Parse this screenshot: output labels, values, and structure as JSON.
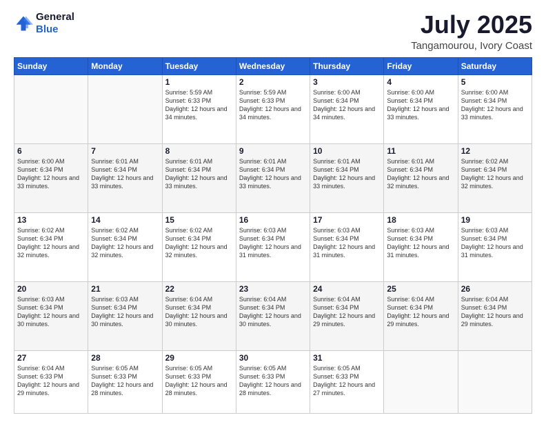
{
  "logo": {
    "line1": "General",
    "line2": "Blue"
  },
  "title": "July 2025",
  "subtitle": "Tangamourou, Ivory Coast",
  "days_header": [
    "Sunday",
    "Monday",
    "Tuesday",
    "Wednesday",
    "Thursday",
    "Friday",
    "Saturday"
  ],
  "weeks": [
    [
      {
        "day": "",
        "info": ""
      },
      {
        "day": "",
        "info": ""
      },
      {
        "day": "1",
        "info": "Sunrise: 5:59 AM\nSunset: 6:33 PM\nDaylight: 12 hours and 34 minutes."
      },
      {
        "day": "2",
        "info": "Sunrise: 5:59 AM\nSunset: 6:33 PM\nDaylight: 12 hours and 34 minutes."
      },
      {
        "day": "3",
        "info": "Sunrise: 6:00 AM\nSunset: 6:34 PM\nDaylight: 12 hours and 34 minutes."
      },
      {
        "day": "4",
        "info": "Sunrise: 6:00 AM\nSunset: 6:34 PM\nDaylight: 12 hours and 33 minutes."
      },
      {
        "day": "5",
        "info": "Sunrise: 6:00 AM\nSunset: 6:34 PM\nDaylight: 12 hours and 33 minutes."
      }
    ],
    [
      {
        "day": "6",
        "info": "Sunrise: 6:00 AM\nSunset: 6:34 PM\nDaylight: 12 hours and 33 minutes."
      },
      {
        "day": "7",
        "info": "Sunrise: 6:01 AM\nSunset: 6:34 PM\nDaylight: 12 hours and 33 minutes."
      },
      {
        "day": "8",
        "info": "Sunrise: 6:01 AM\nSunset: 6:34 PM\nDaylight: 12 hours and 33 minutes."
      },
      {
        "day": "9",
        "info": "Sunrise: 6:01 AM\nSunset: 6:34 PM\nDaylight: 12 hours and 33 minutes."
      },
      {
        "day": "10",
        "info": "Sunrise: 6:01 AM\nSunset: 6:34 PM\nDaylight: 12 hours and 33 minutes."
      },
      {
        "day": "11",
        "info": "Sunrise: 6:01 AM\nSunset: 6:34 PM\nDaylight: 12 hours and 32 minutes."
      },
      {
        "day": "12",
        "info": "Sunrise: 6:02 AM\nSunset: 6:34 PM\nDaylight: 12 hours and 32 minutes."
      }
    ],
    [
      {
        "day": "13",
        "info": "Sunrise: 6:02 AM\nSunset: 6:34 PM\nDaylight: 12 hours and 32 minutes."
      },
      {
        "day": "14",
        "info": "Sunrise: 6:02 AM\nSunset: 6:34 PM\nDaylight: 12 hours and 32 minutes."
      },
      {
        "day": "15",
        "info": "Sunrise: 6:02 AM\nSunset: 6:34 PM\nDaylight: 12 hours and 32 minutes."
      },
      {
        "day": "16",
        "info": "Sunrise: 6:03 AM\nSunset: 6:34 PM\nDaylight: 12 hours and 31 minutes."
      },
      {
        "day": "17",
        "info": "Sunrise: 6:03 AM\nSunset: 6:34 PM\nDaylight: 12 hours and 31 minutes."
      },
      {
        "day": "18",
        "info": "Sunrise: 6:03 AM\nSunset: 6:34 PM\nDaylight: 12 hours and 31 minutes."
      },
      {
        "day": "19",
        "info": "Sunrise: 6:03 AM\nSunset: 6:34 PM\nDaylight: 12 hours and 31 minutes."
      }
    ],
    [
      {
        "day": "20",
        "info": "Sunrise: 6:03 AM\nSunset: 6:34 PM\nDaylight: 12 hours and 30 minutes."
      },
      {
        "day": "21",
        "info": "Sunrise: 6:03 AM\nSunset: 6:34 PM\nDaylight: 12 hours and 30 minutes."
      },
      {
        "day": "22",
        "info": "Sunrise: 6:04 AM\nSunset: 6:34 PM\nDaylight: 12 hours and 30 minutes."
      },
      {
        "day": "23",
        "info": "Sunrise: 6:04 AM\nSunset: 6:34 PM\nDaylight: 12 hours and 30 minutes."
      },
      {
        "day": "24",
        "info": "Sunrise: 6:04 AM\nSunset: 6:34 PM\nDaylight: 12 hours and 29 minutes."
      },
      {
        "day": "25",
        "info": "Sunrise: 6:04 AM\nSunset: 6:34 PM\nDaylight: 12 hours and 29 minutes."
      },
      {
        "day": "26",
        "info": "Sunrise: 6:04 AM\nSunset: 6:34 PM\nDaylight: 12 hours and 29 minutes."
      }
    ],
    [
      {
        "day": "27",
        "info": "Sunrise: 6:04 AM\nSunset: 6:33 PM\nDaylight: 12 hours and 29 minutes."
      },
      {
        "day": "28",
        "info": "Sunrise: 6:05 AM\nSunset: 6:33 PM\nDaylight: 12 hours and 28 minutes."
      },
      {
        "day": "29",
        "info": "Sunrise: 6:05 AM\nSunset: 6:33 PM\nDaylight: 12 hours and 28 minutes."
      },
      {
        "day": "30",
        "info": "Sunrise: 6:05 AM\nSunset: 6:33 PM\nDaylight: 12 hours and 28 minutes."
      },
      {
        "day": "31",
        "info": "Sunrise: 6:05 AM\nSunset: 6:33 PM\nDaylight: 12 hours and 27 minutes."
      },
      {
        "day": "",
        "info": ""
      },
      {
        "day": "",
        "info": ""
      }
    ]
  ]
}
